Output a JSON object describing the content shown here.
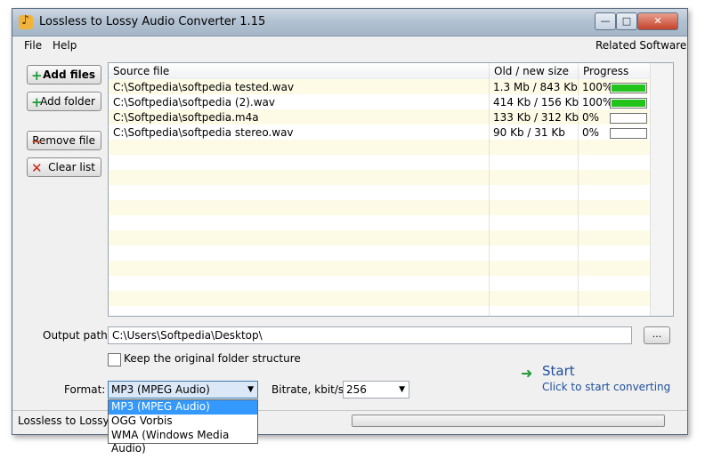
{
  "window": {
    "title": "Lossless to Lossy Audio Converter 1.15",
    "controls": {
      "minimize": "—",
      "maximize": "□",
      "close": "✕"
    }
  },
  "menu": {
    "file": "File",
    "help": "Help",
    "related": "Related Software"
  },
  "buttons": {
    "add_files": "Add files",
    "add_folder": "Add folder",
    "remove_file": "Remove file",
    "clear_list": "Clear list"
  },
  "grid": {
    "headers": {
      "source": "Source file",
      "size": "Old / new size",
      "progress": "Progress"
    },
    "rows": [
      {
        "source": "C:\\Softpedia\\softpedia tested.wav",
        "size": "1.3 Mb / 843 Kb",
        "progress": "100%",
        "fill": 1.0
      },
      {
        "source": "C:\\Softpedia\\softpedia (2).wav",
        "size": "414 Kb / 156 Kb",
        "progress": "100%",
        "fill": 1.0
      },
      {
        "source": "C:\\Softpedia\\softpedia.m4a",
        "size": "133 Kb / 312 Kb",
        "progress": "0%",
        "fill": 0
      },
      {
        "source": "C:\\Softpedia\\softpedia stereo.wav",
        "size": "90 Kb / 31 Kb",
        "progress": "0%",
        "fill": 0
      }
    ]
  },
  "output": {
    "label": "Output path:",
    "value": "C:\\Users\\Softpedia\\Desktop\\",
    "browse": "..."
  },
  "keep_structure": {
    "label": "Keep the original folder structure",
    "checked": false
  },
  "format": {
    "label": "Format:",
    "selected": "MP3 (MPEG Audio)",
    "options": [
      "MP3 (MPEG Audio)",
      "OGG Vorbis",
      "WMA (Windows Media Audio)"
    ]
  },
  "bitrate": {
    "label": "Bitrate, kbit/s:",
    "value": "256"
  },
  "start": {
    "title": "Start",
    "subtitle": "Click to start converting"
  },
  "status": {
    "text": "Lossless to Lossy A"
  },
  "colors": {
    "progress_fill": "#22c41c",
    "selection": "#3399ff",
    "link": "#1f4f9a",
    "row_alt": "#fdfbe6"
  }
}
